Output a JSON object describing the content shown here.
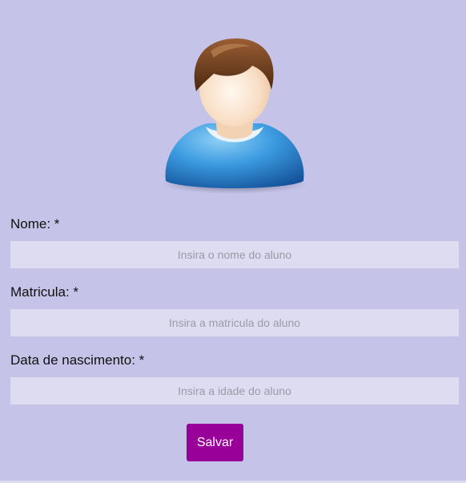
{
  "form": {
    "name": {
      "label": "Nome: *",
      "placeholder": "Insira o nome do aluno",
      "value": ""
    },
    "registration": {
      "label": "Matricula: *",
      "placeholder": "Insira a matricula do aluno",
      "value": ""
    },
    "birthdate": {
      "label": "Data de nascimento: *",
      "placeholder": "Insira a idade do aluno",
      "value": ""
    },
    "save_label": "Salvar"
  },
  "icons": {
    "avatar": "user-avatar-icon"
  },
  "colors": {
    "background": "#c5c3e8",
    "input_background": "#dedcf1",
    "button": "#990099",
    "button_text": "#ffffff"
  }
}
